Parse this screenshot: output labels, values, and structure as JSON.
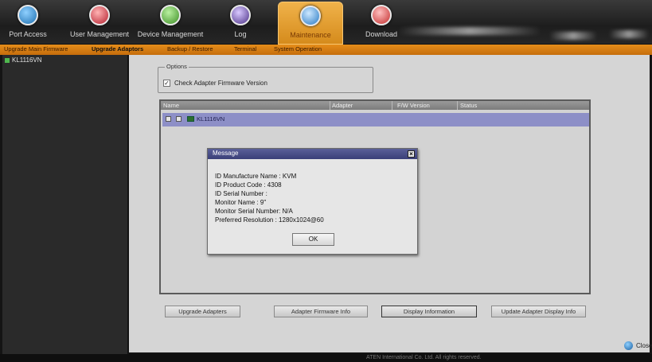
{
  "nav": {
    "tabs": [
      {
        "label": "Port Access",
        "icon": "port-access-icon"
      },
      {
        "label": "User Management",
        "icon": "user-management-icon"
      },
      {
        "label": "Device Management",
        "icon": "device-management-icon"
      },
      {
        "label": "Log",
        "icon": "log-icon"
      },
      {
        "label": "Maintenance",
        "icon": "maintenance-icon",
        "active": true
      },
      {
        "label": "Download",
        "icon": "download-icon"
      }
    ]
  },
  "subnav": {
    "items": [
      {
        "label": "Upgrade Main Firmware"
      },
      {
        "label": "Upgrade Adaptors",
        "active": true
      },
      {
        "label": "Backup / Restore"
      },
      {
        "label": "Terminal"
      },
      {
        "label": "System Operation"
      }
    ]
  },
  "sidebar": {
    "tree_root": "KL1116VN"
  },
  "options": {
    "legend": "Options",
    "check_label": "Check Adapter Firmware Version",
    "checked": true,
    "check_mark": "✓"
  },
  "grid": {
    "columns": [
      "Name",
      "Adapter",
      "F/W Version",
      "Status"
    ],
    "rows": [
      {
        "name": "KL1116VN"
      }
    ]
  },
  "buttons": {
    "upgrade": "Upgrade Adapters",
    "firmware_info": "Adapter Firmware Info",
    "display_info": "Display Information",
    "update_display": "Update Adapter Display Info"
  },
  "modal": {
    "title": "Message",
    "close_glyph": "×",
    "lines": [
      "ID Manufacture Name : KVM",
      "ID Product Code : 4308",
      "ID Serial Number :",
      "Monitor Name : 9\"",
      "Monitor Serial Number: N/A",
      "Preferred Resolution : 1280x1024@60"
    ],
    "ok_label": "OK"
  },
  "footer": {
    "copyright": "ATEN International Co. Ltd. All rights reserved.",
    "close_label": "Close"
  },
  "colors": {
    "accent": "#e58d1a",
    "modal_title": "#4a4f88",
    "selected_row": "#8d8fc7"
  }
}
